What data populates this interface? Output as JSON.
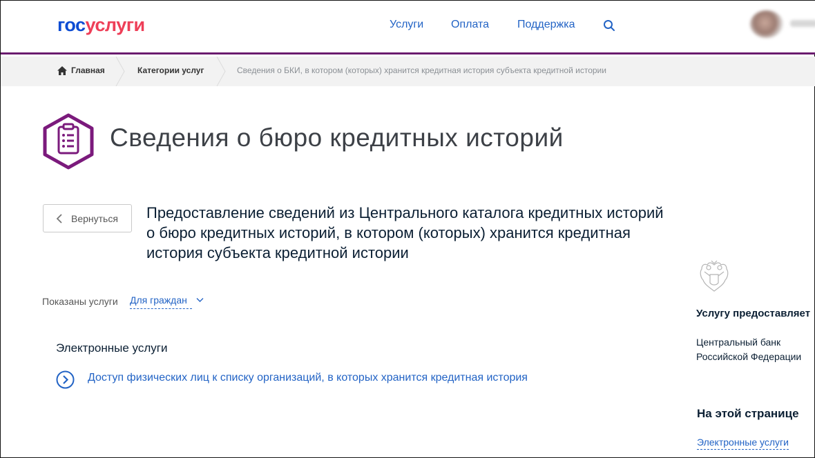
{
  "header": {
    "logo_gos": "гос",
    "logo_uslugi": "услуги",
    "nav": [
      "Услуги",
      "Оплата",
      "Поддержка"
    ],
    "brand_color": "#0d4cd3",
    "accent_color": "#ee3f58",
    "divider_color": "#6a1b6e",
    "search_icon": "search-icon"
  },
  "breadcrumb": {
    "home": "Главная",
    "categories": "Категории услуг",
    "current": "Сведения о БКИ, в котором (которых) хранится кредитная история субъекта кредитной истории"
  },
  "page": {
    "title": "Сведения о бюро кредитных историй",
    "title_icon": "clipboard-list-icon",
    "back_label": "Вернуться",
    "service_heading": "Предоставление сведений из Центрального каталога кредитных историй о бюро кредитных историй, в котором (которых) хранится кредитная история субъекта кредитной истории",
    "filter_label": "Показаны услуги",
    "filter_value": "Для граждан",
    "section_title": "Электронные услуги",
    "service_link": "Доступ физических лиц к списку организаций, в которых хранится кредитная история"
  },
  "sidebar": {
    "provider_title": "Услугу предоставляет",
    "provider_name": "Центральный банк Российской Федерации",
    "onpage_title": "На этой странице",
    "onpage_link": "Электронные услуги"
  }
}
